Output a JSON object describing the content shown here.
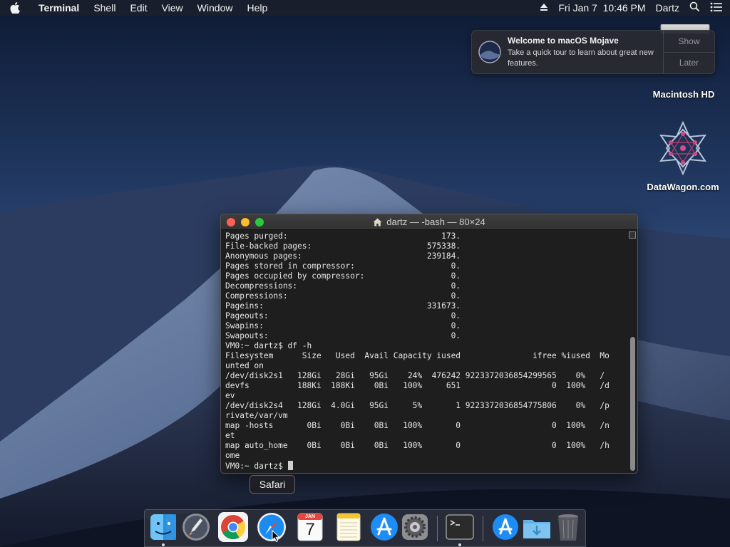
{
  "menubar": {
    "app_name": "Terminal",
    "menus": [
      "Shell",
      "Edit",
      "View",
      "Window",
      "Help"
    ],
    "clock": "Fri Jan 7  10:46 PM",
    "user": "Dartz"
  },
  "notification": {
    "title": "Welcome to macOS Mojave",
    "body": "Take a quick tour to learn about great new features.",
    "show_label": "Show",
    "later_label": "Later"
  },
  "desktop": {
    "hd_label": "Macintosh HD",
    "datawagon_label": "DataWagon.com"
  },
  "terminal": {
    "title": "dartz — -bash — 80×24",
    "lines": [
      "Pages purged:                                173.",
      "File-backed pages:                        575338.",
      "Anonymous pages:                          239184.",
      "Pages stored in compressor:                    0.",
      "Pages occupied by compressor:                  0.",
      "Decompressions:                                0.",
      "Compressions:                                  0.",
      "Pageins:                                  331673.",
      "Pageouts:                                      0.",
      "Swapins:                                       0.",
      "Swapouts:                                      0.",
      "VM0:~ dartz$ df -h",
      "Filesystem      Size   Used  Avail Capacity iused               ifree %iused  Mo",
      "unted on",
      "/dev/disk2s1   128Gi   28Gi   95Gi    24%  476242 9223372036854299565    0%   /",
      "devfs          188Ki  188Ki    0Bi   100%     651                   0  100%   /d",
      "ev",
      "/dev/disk2s4   128Gi  4.0Gi   95Gi     5%       1 9223372036854775806    0%   /p",
      "rivate/var/vm",
      "map -hosts       0Bi    0Bi    0Bi   100%       0                   0  100%   /n",
      "et",
      "map auto_home    0Bi    0Bi    0Bi   100%       0                   0  100%   /h",
      "ome"
    ],
    "prompt": "VM0:~ dartz$ "
  },
  "dock": {
    "tooltip": "Safari",
    "items": [
      "finder-icon",
      "launchpad-icon",
      "chrome-icon",
      "safari-icon",
      "calendar-icon",
      "notes-icon",
      "app-store-icon",
      "system-preferences-icon",
      "terminal-icon",
      "app-store-downloads-icon",
      "downloads-folder-icon",
      "trash-icon"
    ],
    "calendar_month": "JAN",
    "calendar_day": "7"
  },
  "colors": {
    "accent_red": "#fe5f57",
    "accent_yellow": "#febc2e",
    "accent_green": "#28c840"
  }
}
